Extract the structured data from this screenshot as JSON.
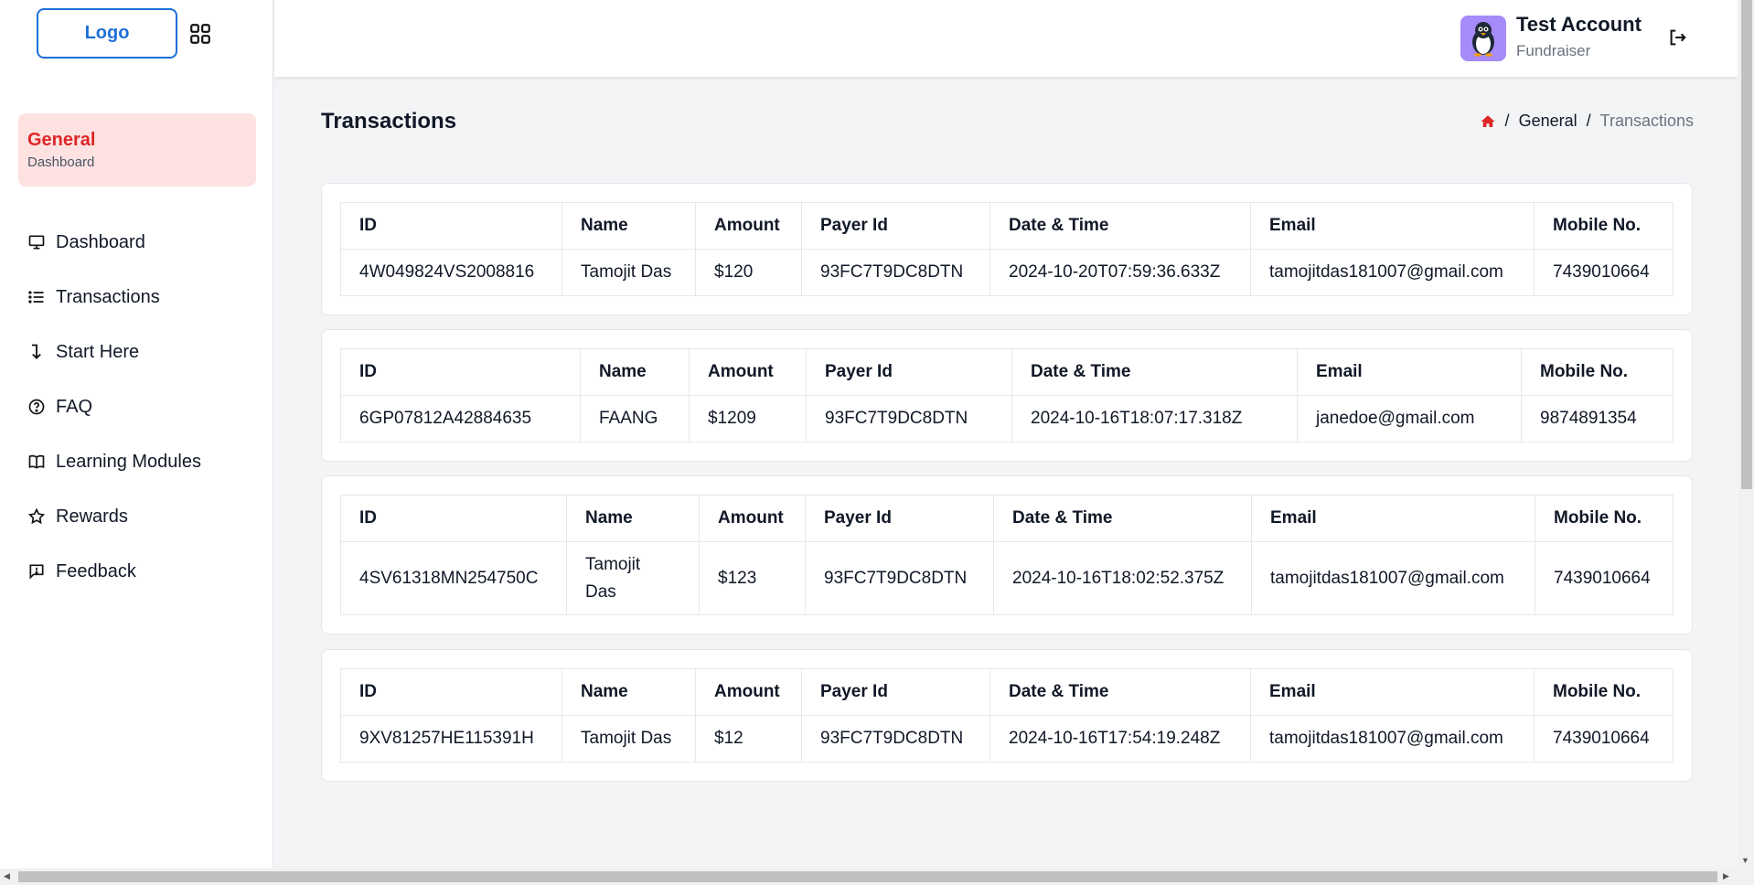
{
  "sidebar": {
    "logo_label": "Logo",
    "section_title": "General",
    "section_subtitle": "Dashboard",
    "items": [
      {
        "label": "Dashboard",
        "icon": "monitor-icon"
      },
      {
        "label": "Transactions",
        "icon": "list-icon"
      },
      {
        "label": "Start Here",
        "icon": "arrow-down-icon"
      },
      {
        "label": "FAQ",
        "icon": "question-icon"
      },
      {
        "label": "Learning Modules",
        "icon": "book-icon"
      },
      {
        "label": "Rewards",
        "icon": "star-icon"
      },
      {
        "label": "Feedback",
        "icon": "feedback-icon"
      }
    ]
  },
  "header": {
    "user_name": "Test Account",
    "user_role": "Fundraiser"
  },
  "page": {
    "title": "Transactions",
    "breadcrumb": [
      "General",
      "Transactions"
    ]
  },
  "columns": [
    "ID",
    "Name",
    "Amount",
    "Payer Id",
    "Date & Time",
    "Email",
    "Mobile No."
  ],
  "transactions": [
    {
      "id": "4W049824VS2008816",
      "name": "Tamojit Das",
      "amount": "$120",
      "payer_id": "93FC7T9DC8DTN",
      "datetime": "2024-10-20T07:59:36.633Z",
      "email": "tamojitdas181007@gmail.com",
      "mobile": "7439010664"
    },
    {
      "id": "6GP07812A42884635",
      "name": "FAANG",
      "amount": "$1209",
      "payer_id": "93FC7T9DC8DTN",
      "datetime": "2024-10-16T18:07:17.318Z",
      "email": "janedoe@gmail.com",
      "mobile": "9874891354"
    },
    {
      "id": "4SV61318MN254750C",
      "name": "Tamojit Das",
      "amount": "$123",
      "payer_id": "93FC7T9DC8DTN",
      "datetime": "2024-10-16T18:02:52.375Z",
      "email": "tamojitdas181007@gmail.com",
      "mobile": "7439010664"
    },
    {
      "id": "9XV81257HE115391H",
      "name": "Tamojit Das",
      "amount": "$12",
      "payer_id": "93FC7T9DC8DTN",
      "datetime": "2024-10-16T17:54:19.248Z",
      "email": "tamojitdas181007@gmail.com",
      "mobile": "7439010664"
    }
  ],
  "colors": {
    "accent": "#dc2626",
    "brand": "#1d6fd8",
    "avatar_bg": "#a78bfa"
  }
}
